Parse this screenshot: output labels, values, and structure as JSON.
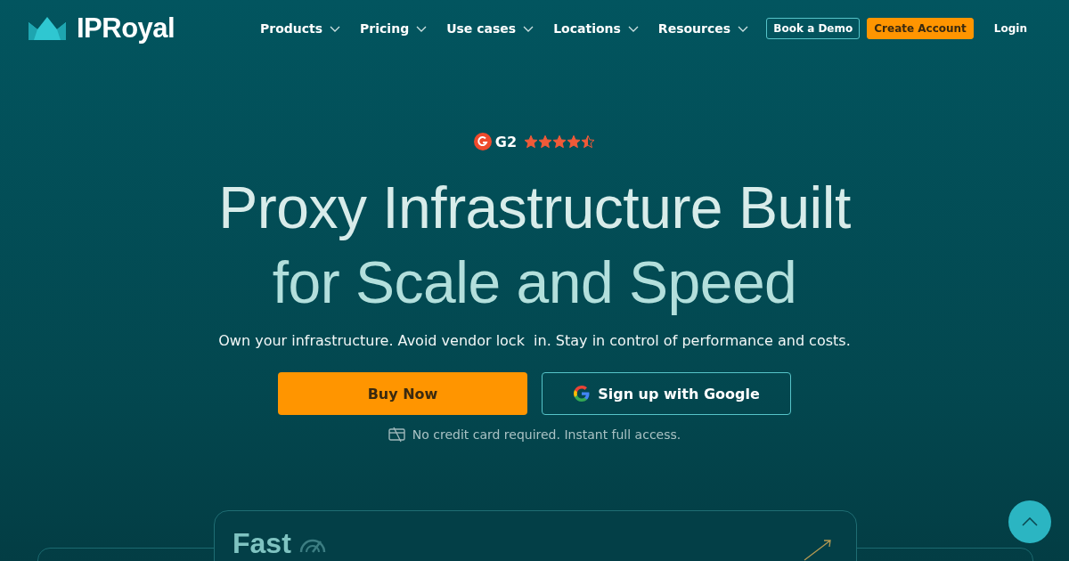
{
  "brand": {
    "name": "IPRoyal"
  },
  "nav": [
    {
      "label": "Products"
    },
    {
      "label": "Pricing"
    },
    {
      "label": "Use cases"
    },
    {
      "label": "Locations"
    },
    {
      "label": "Resources"
    }
  ],
  "actions": [
    {
      "label": "Book a Demo",
      "kind": "outline"
    },
    {
      "label": "Create Account",
      "kind": "primary"
    },
    {
      "label": "Login",
      "kind": "text"
    }
  ],
  "rating": {
    "label": "G2",
    "stars": 4.5
  },
  "hero": {
    "title_lines": [
      "Proxy Infrastructure Built",
      "for Scale and Speed"
    ],
    "subtitle": "Own your infrastructure. Avoid vendor lock  in. Stay in control of performance and costs.",
    "buttons": [
      {
        "label": "Buy Now",
        "kind": "primary"
      },
      {
        "label": "Sign up with Google",
        "kind": "google"
      }
    ],
    "note": "No credit card required. Instant full access."
  },
  "feature_card": {
    "title": "Fast"
  }
}
